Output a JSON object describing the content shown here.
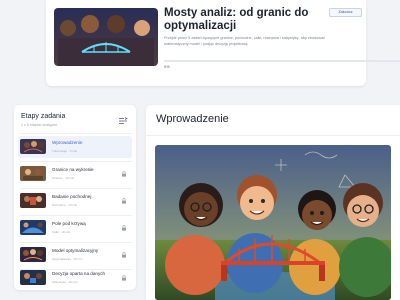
{
  "header": {
    "title": "Mosty analiz: od granic do optymalizacji",
    "description": "Przejdź przez 5 zadań łączących granice, pochodne, całki, równania i statystykę, aby zbudować matematyczny model i podjąć decyzję projektową.",
    "finish_label": "Zakończ",
    "progress_percent": 0,
    "progress_label": "0%",
    "thumbnail": "bridge-illustration"
  },
  "sidebar": {
    "title": "Etapy zadania",
    "subtitle": "1 z 6 etapów dostępne",
    "toggle_icon": "collapse-panel-icon",
    "items": [
      {
        "label": "Wprowadzenie",
        "meta": "Tutaj wstęp · 5 min",
        "active": true,
        "locked": false
      },
      {
        "label": "Granice na wykresie",
        "meta": "Granice · 10 min",
        "active": false,
        "locked": true
      },
      {
        "label": "Badanie pochodnej",
        "meta": "Pochodne · 10 min",
        "active": false,
        "locked": true
      },
      {
        "label": "Pole pod krzywą",
        "meta": "Całki · 10 min",
        "active": false,
        "locked": true
      },
      {
        "label": "Model optymalizacyjny",
        "meta": "Optymalizacja · 15 min",
        "active": false,
        "locked": true
      },
      {
        "label": "Decyzja oparta na danych",
        "meta": "Statystyka · 10 min",
        "active": false,
        "locked": true
      }
    ]
  },
  "main": {
    "title": "Wprowadzenie",
    "hero_image": "kids-building-bridge-illustration"
  },
  "colors": {
    "accent": "#3c63c8",
    "progress": "#5b7bd6",
    "background": "#f1f3f6",
    "card": "#ffffff"
  }
}
